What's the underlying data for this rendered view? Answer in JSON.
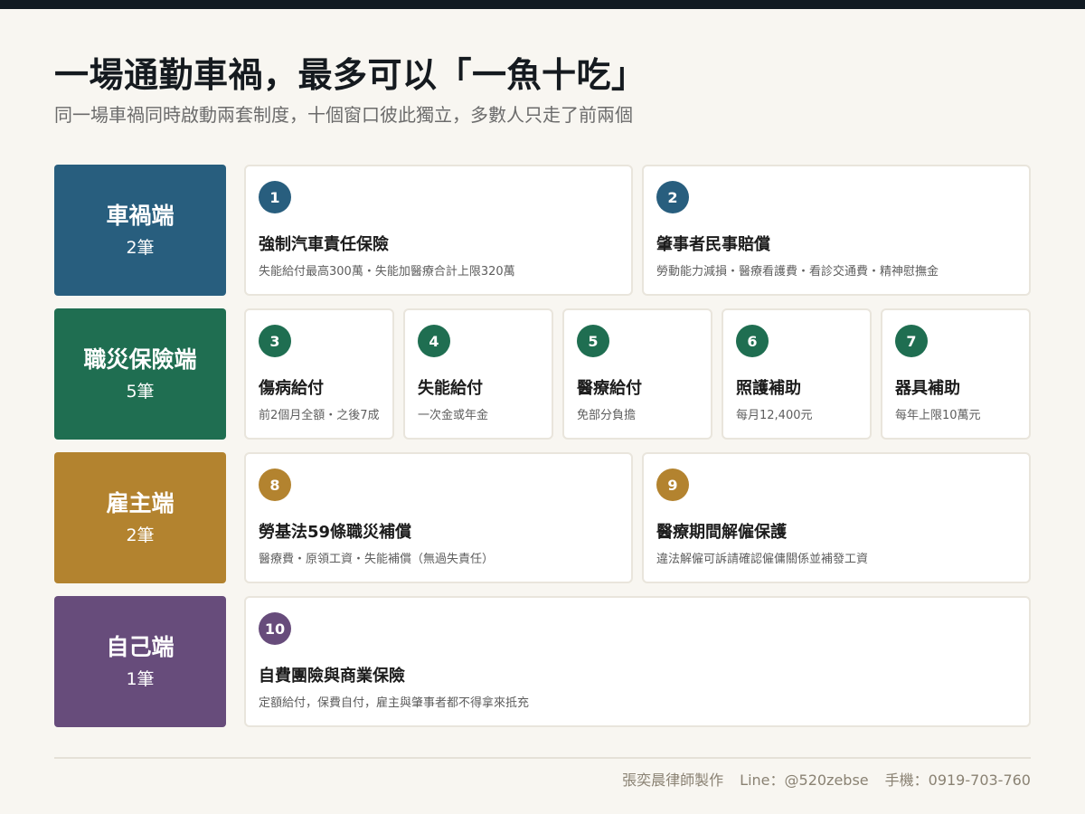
{
  "header": {
    "title": "一場通勤車禍，最多可以「一魚十吃」",
    "subtitle": "同一場車禍同時啟動兩套制度，十個窗口彼此獨立，多數人只走了前兩個"
  },
  "colors": {
    "car_side": "#285e7e",
    "occupational_side": "#1f6e51",
    "employer_side": "#b3832f",
    "self_side": "#674c7b"
  },
  "rows": [
    {
      "category": "車禍端",
      "count": "2筆",
      "cards": [
        {
          "num": "1",
          "title": "強制汽車責任保險",
          "desc": "失能給付最高300萬・失能加醫療合計上限320萬"
        },
        {
          "num": "2",
          "title": "肇事者民事賠償",
          "desc": "勞動能力減損・醫療看護費・看診交通費・精神慰撫金"
        }
      ]
    },
    {
      "category": "職災保險端",
      "count": "5筆",
      "cards": [
        {
          "num": "3",
          "title": "傷病給付",
          "desc": "前2個月全額・之後7成"
        },
        {
          "num": "4",
          "title": "失能給付",
          "desc": "一次金或年金"
        },
        {
          "num": "5",
          "title": "醫療給付",
          "desc": "免部分負擔"
        },
        {
          "num": "6",
          "title": "照護補助",
          "desc": "每月12,400元"
        },
        {
          "num": "7",
          "title": "器具補助",
          "desc": "每年上限10萬元"
        }
      ]
    },
    {
      "category": "雇主端",
      "count": "2筆",
      "cards": [
        {
          "num": "8",
          "title": "勞基法59條職災補償",
          "desc": "醫療費・原領工資・失能補償（無過失責任）"
        },
        {
          "num": "9",
          "title": "醫療期間解僱保護",
          "desc": "違法解僱可訴請確認僱傭關係並補發工資"
        }
      ]
    },
    {
      "category": "自己端",
      "count": "1筆",
      "cards": [
        {
          "num": "10",
          "title": "自費團險與商業保險",
          "desc": "定額給付，保費自付，雇主與肇事者都不得拿來抵充"
        }
      ]
    }
  ],
  "footer": {
    "author": "張奕晨律師製作",
    "line": "Line：@520zebse",
    "phone": "手機：0919-703-760"
  }
}
